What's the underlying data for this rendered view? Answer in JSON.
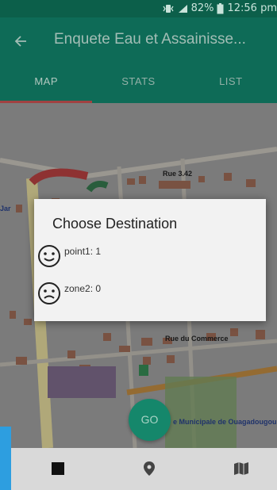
{
  "status_bar": {
    "battery_percent": "82%",
    "time": "12:56 pm",
    "icons": [
      "vibrate-icon",
      "signal-icon",
      "battery-icon"
    ]
  },
  "app_bar": {
    "back_icon": "arrow-back-icon",
    "title": "Enquete Eau et Assainisse..."
  },
  "tabs": [
    {
      "label": "MAP",
      "active": true
    },
    {
      "label": "STATS",
      "active": false
    },
    {
      "label": "LIST",
      "active": false
    }
  ],
  "map": {
    "labels": {
      "street_1": "Rue 3.42",
      "street_2": "Rue du Commerce",
      "place": "e Municipale de Ouagadougou",
      "left_edge": "Jar"
    }
  },
  "dialog": {
    "title": "Choose Destination",
    "items": [
      {
        "label": "point1: 1",
        "icon": "smiley-happy-icon"
      },
      {
        "label": "zone2: 0",
        "icon": "smiley-sad-icon"
      }
    ]
  },
  "go_button": {
    "label": "GO"
  },
  "bottom_nav": {
    "items": [
      {
        "icon": "stop-square-icon"
      },
      {
        "icon": "location-pin-icon"
      },
      {
        "icon": "map-icon"
      }
    ]
  },
  "colors": {
    "primary": "#117a63",
    "primary_dark": "#0c5f4a",
    "tab_indicator": "#b84a4a",
    "fab": "#15876b",
    "accent_blue": "#2d9ee0"
  }
}
